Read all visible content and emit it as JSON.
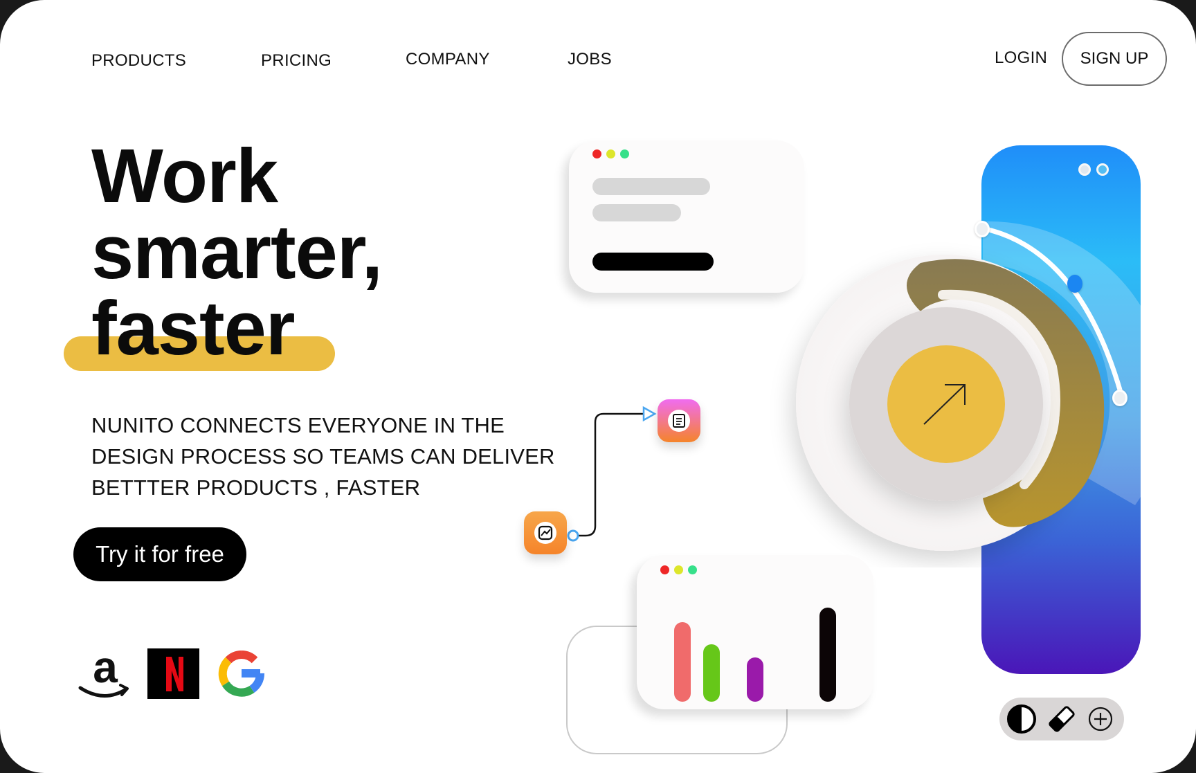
{
  "nav": {
    "products": "PRODUCTS",
    "pricing": "PRICING",
    "company": "COMPANY",
    "jobs": "JOBS",
    "login": "LOGIN",
    "signup": "SIGN UP"
  },
  "hero": {
    "title_line1": "Work",
    "title_line2": "smarter,",
    "title_line3": "faster",
    "description_line1": "NUNITO CONNECTS EVERYONE IN THE",
    "description_line2": "DESIGN PROCESS SO TEAMS CAN DELIVER",
    "description_line3": "BETTTER PRODUCTS , FASTER",
    "cta_label": "Try it for free"
  },
  "logos": [
    "amazon-logo",
    "netflix-logo",
    "google-logo"
  ],
  "illustration": {
    "window_dot_colors": [
      "#ee2727",
      "#dde62b",
      "#37e08a"
    ],
    "mini_chart_values": [
      0.72,
      0.52,
      0.4,
      0.85
    ],
    "mini_chart_colors": [
      "#f06b6b",
      "#66c719",
      "#9a1aaa",
      "#0c0506"
    ],
    "accent": "#ebbd43",
    "dial_gold": "#8c7a4b",
    "phone_gradient": [
      "#1f8ef9",
      "#2bbcf7",
      "#3f9de6",
      "#3b63d6",
      "#4a16b8"
    ],
    "toolbar_icons": [
      "contrast-icon",
      "eraser-icon",
      "add-circle-icon"
    ],
    "node_icons": [
      "chart-node-icon",
      "document-node-icon"
    ]
  }
}
